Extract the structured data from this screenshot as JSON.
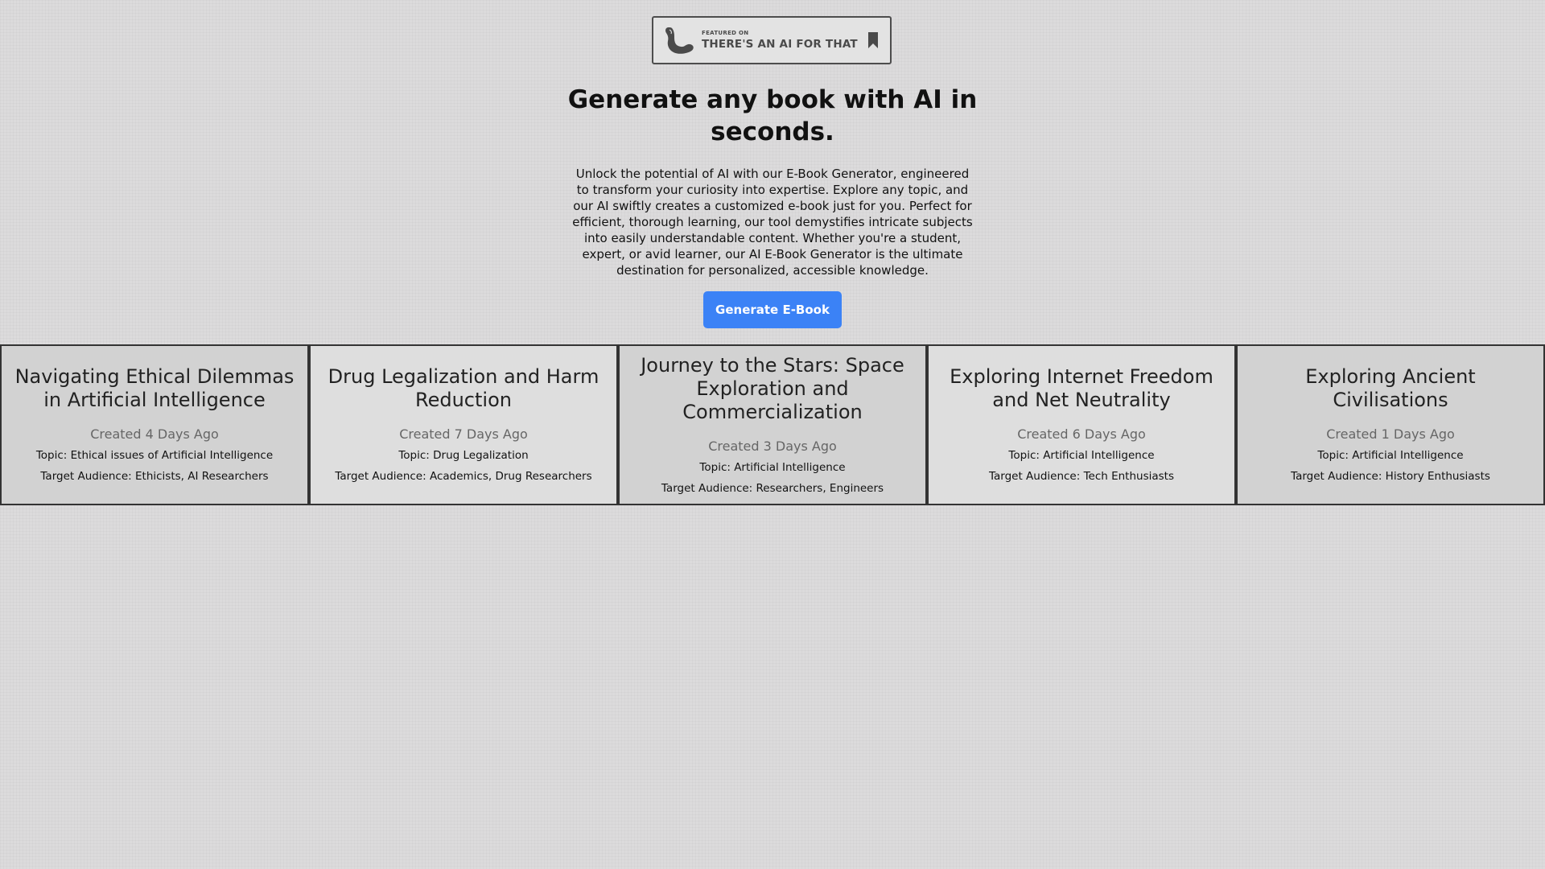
{
  "badge": {
    "featured_label": "FEATURED ON",
    "site_name": "THERE'S AN AI FOR THAT",
    "logo_icon": "muscle-arm-icon",
    "bookmark_icon": "bookmark-icon",
    "color": "#4a4a4a"
  },
  "hero": {
    "title": "Generate any book with AI in seconds.",
    "description": "Unlock the potential of AI with our E-Book Generator, engineered to transform your curiosity into expertise. Explore any topic, and our AI swiftly creates a customized e-book just for you. Perfect for efficient, thorough learning, our tool demystifies intricate subjects into easily understandable content. Whether you're a student, expert, or avid learner, our AI E-Book Generator is the ultimate destination for personalized, accessible knowledge.",
    "cta_label": "Generate E-Book",
    "cta_color": "#3b82f6"
  },
  "books": [
    {
      "title": "Navigating Ethical Dilemmas in Artificial Intelligence",
      "created": "Created 4 Days Ago",
      "topic": "Topic: Ethical issues of Artificial Intelligence",
      "audience": "Target Audience: Ethicists, AI Researchers"
    },
    {
      "title": "Drug Legalization and Harm Reduction",
      "created": "Created 7 Days Ago",
      "topic": "Topic: Drug Legalization",
      "audience": "Target Audience: Academics, Drug Researchers"
    },
    {
      "title": "Journey to the Stars: Space Exploration and Commercialization",
      "created": "Created 3 Days Ago",
      "topic": "Topic: Artificial Intelligence",
      "audience": "Target Audience: Researchers, Engineers"
    },
    {
      "title": "Exploring Internet Freedom and Net Neutrality",
      "created": "Created 6 Days Ago",
      "topic": "Topic: Artificial Intelligence",
      "audience": "Target Audience: Tech Enthusiasts"
    },
    {
      "title": "Exploring Ancient Civilisations",
      "created": "Created 1 Days Ago",
      "topic": "Topic: Artificial Intelligence",
      "audience": "Target Audience: History Enthusiasts"
    }
  ]
}
